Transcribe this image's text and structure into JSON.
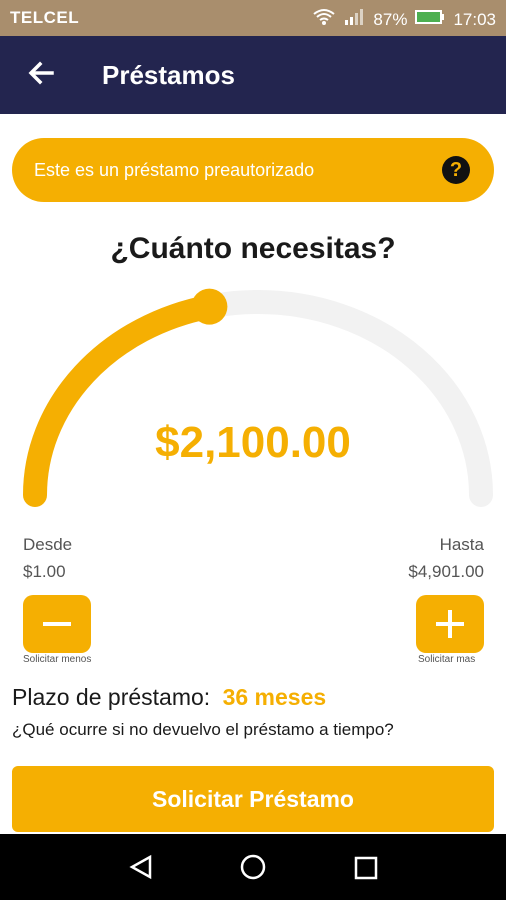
{
  "status_bar": {
    "carrier": "TELCEL",
    "battery": "87%",
    "time": "17:03"
  },
  "app_bar": {
    "title": "Préstamos"
  },
  "banner": {
    "text": "Este es un préstamo preautorizado",
    "help_symbol": "?"
  },
  "loan": {
    "question": "¿Cuánto necesitas?",
    "amount": "$2,100.00",
    "slider_fraction": 0.43,
    "min_label": "Desde",
    "min_value": "$1.00",
    "max_label": "Hasta",
    "max_value": "$4,901.00",
    "decrease_label": "Solicitar menos",
    "increase_label": "Solicitar mas"
  },
  "term": {
    "label": "Plazo de préstamo:",
    "value": "36 meses",
    "link": "¿Qué ocurre si no devuelvo el préstamo a tiempo?"
  },
  "cta": {
    "label": "Solicitar Préstamo"
  },
  "colors": {
    "accent": "#f5af02",
    "app_bar": "#23254f",
    "status_bar": "#a98e6d"
  }
}
